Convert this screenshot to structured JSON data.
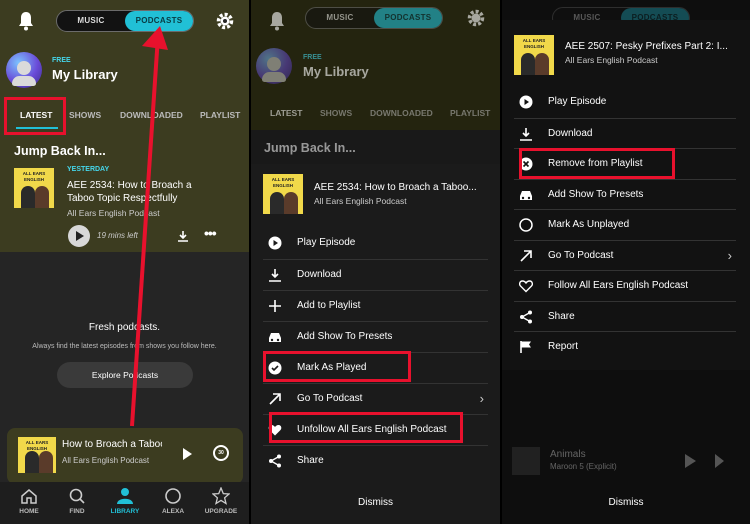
{
  "panel1": {
    "toggle": {
      "music": "MUSIC",
      "podcasts": "PODCASTS"
    },
    "badge": "FREE",
    "library_title": "My Library",
    "tabs": [
      "LATEST",
      "SHOWS",
      "DOWNLOADED",
      "PLAYLIST"
    ],
    "section_title": "Jump Back In...",
    "episode": {
      "date": "YESTERDAY",
      "title": "AEE 2534: How to Broach a Taboo Topic Respectfully",
      "show": "All Ears English Podcast",
      "remaining": "19 mins left"
    },
    "empty_title": "Fresh podcasts.",
    "empty_sub": "Always find the latest episodes from shows you follow here.",
    "explore_button": "Explore Podcasts",
    "mini_player": {
      "title": "How to Broach a Taboo Topic",
      "show": "All Ears English Podcast",
      "skip": "30"
    },
    "nav": [
      "HOME",
      "FIND",
      "LIBRARY",
      "ALEXA",
      "UPGRADE"
    ],
    "art_text": "ALL EARS ENGLISH"
  },
  "panel2": {
    "header": {
      "title": "AEE 2534: How to Broach a Taboo...",
      "show": "All Ears English Podcast"
    },
    "menu": [
      "Play Episode",
      "Download",
      "Add to Playlist",
      "Add Show To Presets",
      "Mark As Played",
      "Go To Podcast",
      "Unfollow All Ears English Podcast",
      "Share"
    ],
    "dismiss": "Dismiss"
  },
  "panel3": {
    "header": {
      "title": "AEE 2507: Pesky Prefixes Part 2: I...",
      "show": "All Ears English Podcast"
    },
    "menu": [
      "Play Episode",
      "Download",
      "Remove from Playlist",
      "Add Show To Presets",
      "Mark As Unplayed",
      "Go To Podcast",
      "Follow All Ears English Podcast",
      "Share",
      "Report"
    ],
    "dismiss": "Dismiss",
    "bg_player": {
      "title": "Animals",
      "show": "Maroon 5 (Explicit)"
    }
  },
  "colors": {
    "accent": "#21c0d6",
    "highlight": "#e8112d",
    "library_bg": "#3c3c20"
  }
}
